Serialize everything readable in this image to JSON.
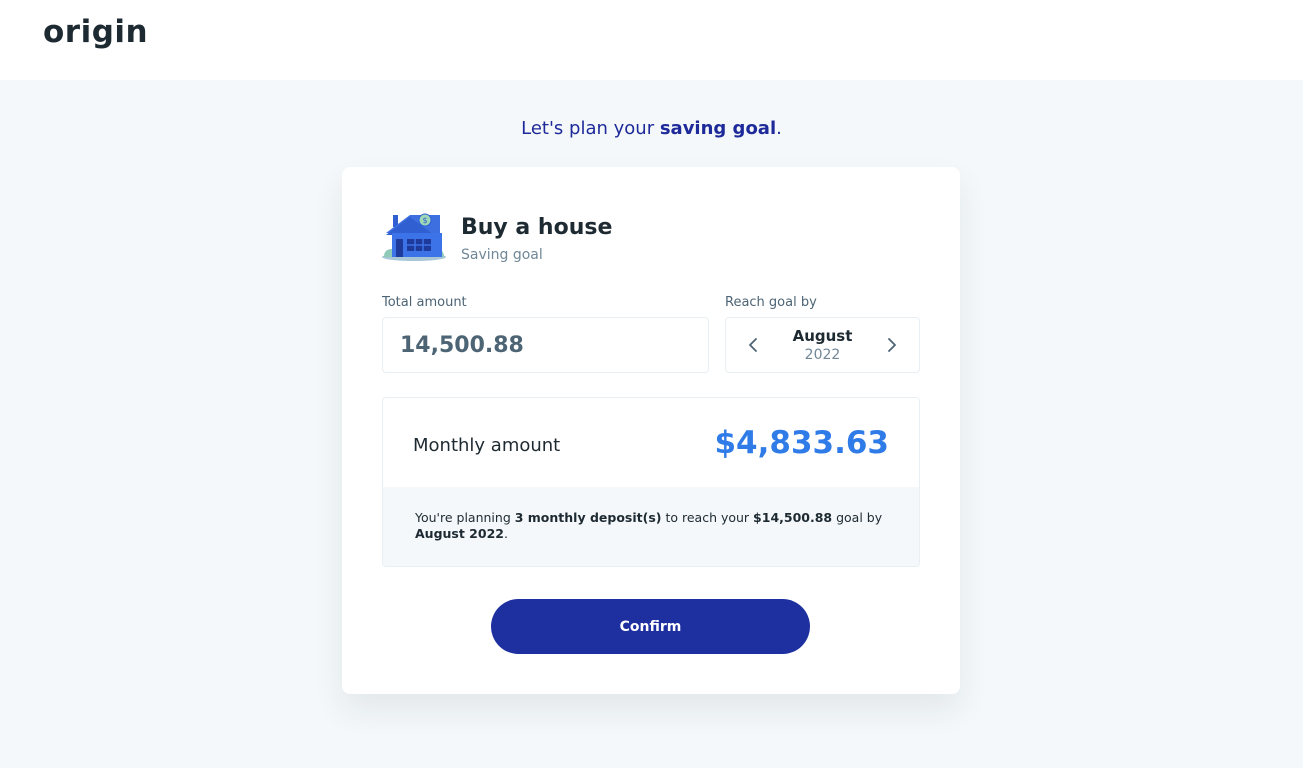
{
  "brand": {
    "logo_text": "origin"
  },
  "headline": {
    "prefix": "Let's plan your ",
    "emphasis": "saving goal",
    "suffix": "."
  },
  "goal": {
    "title": "Buy a house",
    "subtitle": "Saving goal",
    "icon": "house-icon"
  },
  "form": {
    "total_label": "Total amount",
    "total_value": "14,500.88",
    "reach_label": "Reach goal by",
    "month": "August",
    "year": "2022"
  },
  "summary": {
    "monthly_label": "Monthly amount",
    "monthly_value": "$4,833.63",
    "text_parts": {
      "p1": "You're planning ",
      "deposits": "3 monthly deposit(s)",
      "p2": " to reach your ",
      "goal_amount": "$14,500.88",
      "p3": " goal by ",
      "goal_date": "August 2022",
      "p4": "."
    }
  },
  "actions": {
    "confirm_label": "Confirm"
  },
  "colors": {
    "primary": "#1e2fa0",
    "accent": "#2f7be8",
    "background": "#f4f8fa",
    "text": "#1e2a32"
  }
}
